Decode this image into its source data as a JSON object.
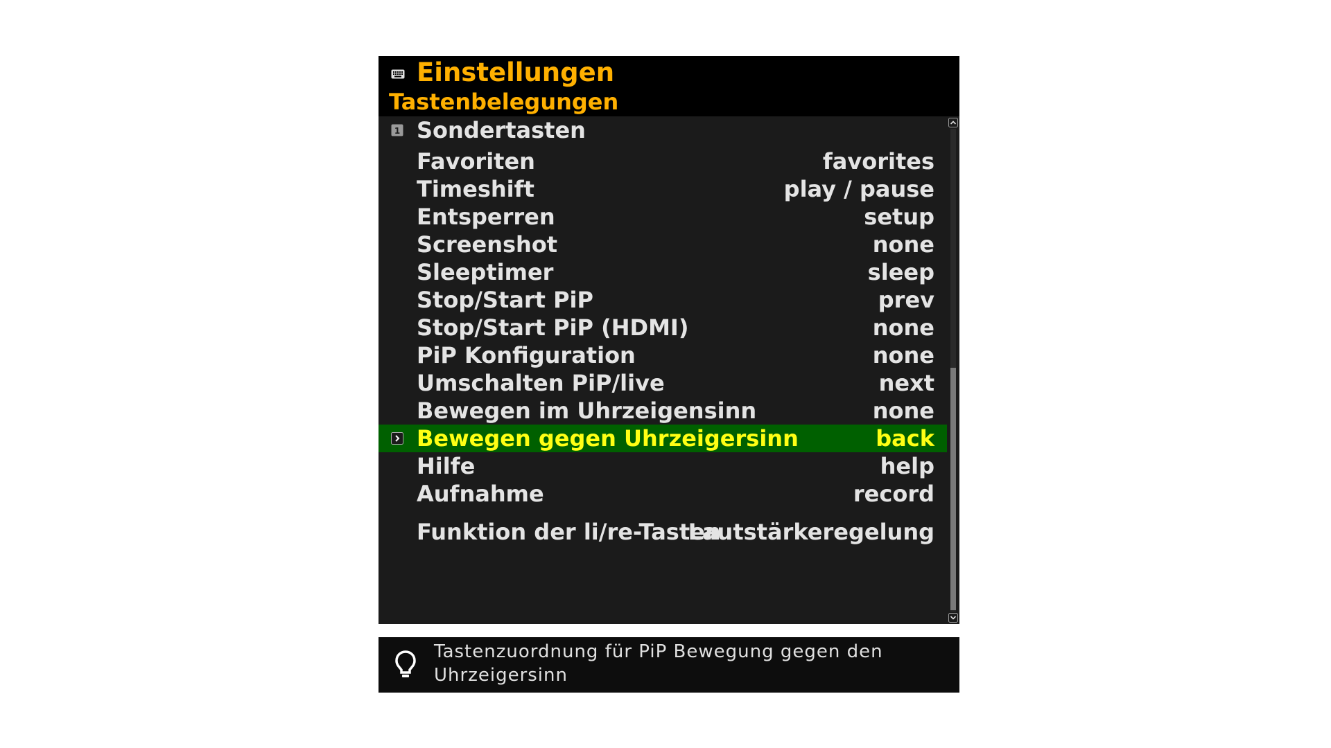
{
  "header": {
    "icon": "keyboard-icon",
    "title": "Einstellungen",
    "subtitle": "Tastenbelegungen"
  },
  "section": {
    "marker": "1",
    "label": "Sondertasten"
  },
  "items": [
    {
      "label": "Favoriten",
      "value": "favorites"
    },
    {
      "label": "Timeshift",
      "value": "play / pause"
    },
    {
      "label": "Entsperren",
      "value": "setup"
    },
    {
      "label": "Screenshot",
      "value": "none"
    },
    {
      "label": "Sleeptimer",
      "value": "sleep"
    },
    {
      "label": "Stop/Start PiP",
      "value": "prev"
    },
    {
      "label": "Stop/Start PiP (HDMI)",
      "value": "none"
    },
    {
      "label": "PiP Konfiguration",
      "value": "none"
    },
    {
      "label": "Umschalten PiP/live",
      "value": "next"
    },
    {
      "label": "Bewegen im Uhrzeigensinn",
      "value": "none"
    },
    {
      "label": "Bewegen gegen Uhrzeigersinn",
      "value": "back",
      "selected": true
    },
    {
      "label": "Hilfe",
      "value": "help"
    },
    {
      "label": "Aufnahme",
      "value": "record"
    }
  ],
  "extra_item": {
    "label": "Funktion der li/re-Tasten",
    "value": "Lautstärkeregelung"
  },
  "hint": {
    "icon": "lightbulb-icon",
    "text": "Tastenzuordnung für PiP Bewegung gegen den Uhrzeigersinn"
  },
  "colors": {
    "title": "#ffb000",
    "selected_bg": "#006000",
    "selected_text": "#ffff14",
    "text": "#e4e4e4",
    "panel_bg": "#1b1b1b"
  }
}
